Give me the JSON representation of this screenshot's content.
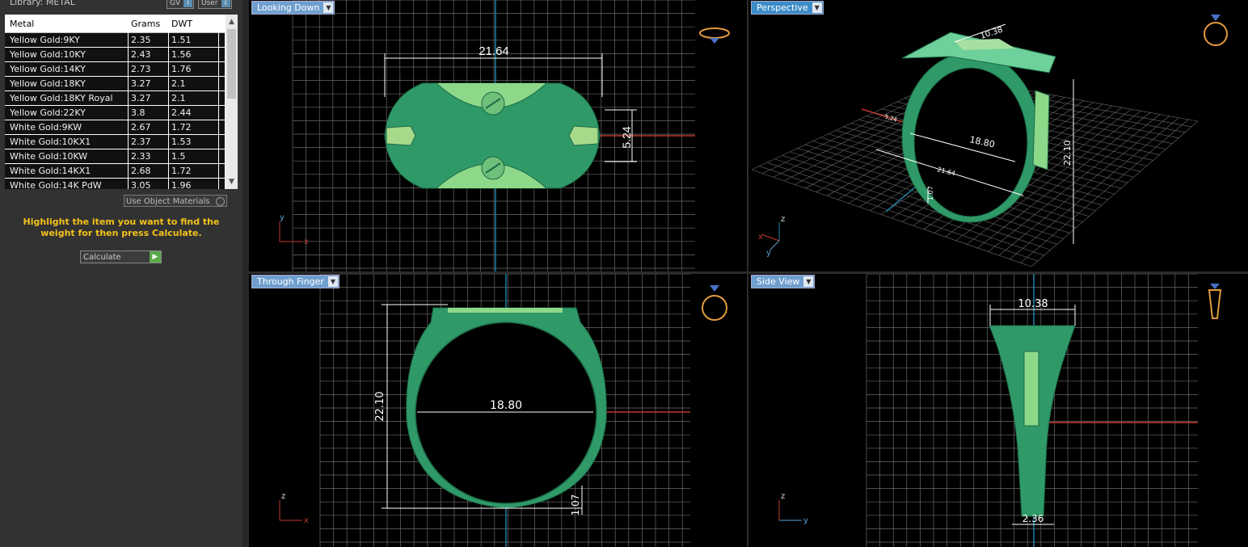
{
  "library": {
    "title": "Library: METAL",
    "gv_label": "GV",
    "user_label": "User"
  },
  "table": {
    "headers": {
      "metal": "Metal",
      "grams": "Grams",
      "dwt": "DWT"
    },
    "rows": [
      {
        "metal": "Yellow Gold:9KY",
        "grams": "2.35",
        "dwt": "1.51"
      },
      {
        "metal": "Yellow Gold:10KY",
        "grams": "2.43",
        "dwt": "1.56"
      },
      {
        "metal": "Yellow Gold:14KY",
        "grams": "2.73",
        "dwt": "1.76"
      },
      {
        "metal": "Yellow Gold:18KY",
        "grams": "3.27",
        "dwt": "2.1"
      },
      {
        "metal": "Yellow Gold:18KY Royal",
        "grams": "3.27",
        "dwt": "2.1"
      },
      {
        "metal": "Yellow Gold:22KY",
        "grams": "3.8",
        "dwt": "2.44"
      },
      {
        "metal": "White Gold:9KW",
        "grams": "2.67",
        "dwt": "1.72"
      },
      {
        "metal": "White Gold:10KX1",
        "grams": "2.37",
        "dwt": "1.53"
      },
      {
        "metal": "White Gold:10KW",
        "grams": "2.33",
        "dwt": "1.5"
      },
      {
        "metal": "White Gold:14KX1",
        "grams": "2.68",
        "dwt": "1.72"
      },
      {
        "metal": "White Gold:14K PdW",
        "grams": "3.05",
        "dwt": "1.96"
      }
    ]
  },
  "use_object_materials": "Use Object Materials",
  "hint": "Highlight the item you want to find the weight for then press Calculate.",
  "calculate_label": "Calculate",
  "viewports": {
    "top_left": {
      "label": "Looking Down",
      "dim_width": "21.64",
      "dim_height": "5.24"
    },
    "top_right": {
      "label": "Perspective",
      "dim_a": "10.38",
      "dim_b": "18.80",
      "dim_c": "22.10",
      "dim_d": "21.64",
      "dim_e": "1.07",
      "dim_f": "5.24"
    },
    "bottom_left": {
      "label": "Through Finger",
      "dim_height": "22.10",
      "dim_inner": "18.80",
      "dim_thick": "1.07"
    },
    "bottom_right": {
      "label": "Side View",
      "dim_top": "10.38",
      "dim_bottom": "2.36"
    }
  },
  "axes": {
    "x": "x",
    "y": "y",
    "z": "z"
  },
  "colors": {
    "ring": "#3fae7a",
    "ring_light": "#6ed09a",
    "grid": "#6a6a6a",
    "axis_red": "#c0392b",
    "axis_blue": "#1f7fa6",
    "label_blue": "#6f9fcf"
  }
}
